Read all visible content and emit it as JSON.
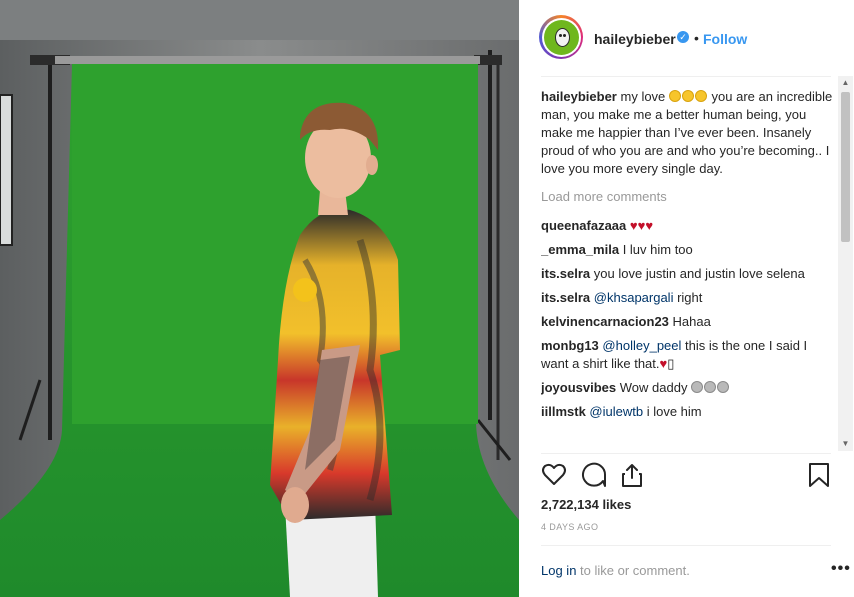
{
  "header": {
    "username": "haileybieber",
    "separator": "•",
    "follow_label": "Follow",
    "verified_icon": "verified-badge-icon"
  },
  "caption": {
    "username": "haileybieber",
    "text_before": "my love",
    "emoji": [
      "smiling-face",
      "smiling-face",
      "smiling-face"
    ],
    "text_after": "you are an incredible man, you make me a better human being, you make me happier than I’ve ever been. Insanely proud of who you are and who you’re becoming.. I love you more every single day."
  },
  "load_more_label": "Load more comments",
  "comments": [
    {
      "user": "queenafazaaa",
      "text": "",
      "hearts": "♥♥♥"
    },
    {
      "user": "_emma_mila",
      "text": "I luv him too"
    },
    {
      "user": "its.selra",
      "text": "you love justin and justin love selena"
    },
    {
      "user": "its.selra",
      "mention": "@khsapargali",
      "text": "right"
    },
    {
      "user": "kelvinencarnacion23",
      "text": "Hahaa"
    },
    {
      "user": "monbg13",
      "mention": "@holley_peel",
      "text": "this is the one I said I want a shirt like that.",
      "hearts": "♥",
      "trailing": "▯"
    },
    {
      "user": "joyousvibes",
      "text": "Wow daddy",
      "emoji": [
        "cat-face",
        "cat-face",
        "cat-face"
      ]
    },
    {
      "user": "iillmstk",
      "mention": "@iulewtb",
      "text": "i love him"
    }
  ],
  "actions": {
    "like_icon": "heart-icon",
    "comment_icon": "comment-icon",
    "share_icon": "share-icon",
    "save_icon": "bookmark-icon"
  },
  "likes": "2,722,134 likes",
  "time_ago": "4 DAYS AGO",
  "footer": {
    "login_label": "Log in",
    "rest": "to like or comment.",
    "more_label": "•••"
  },
  "colors": {
    "link_blue": "#3897f0",
    "dark_link": "#003569",
    "text": "#262626",
    "muted": "#999999",
    "heart_red": "#c3102a",
    "backdrop_green": "#2ea12e"
  }
}
